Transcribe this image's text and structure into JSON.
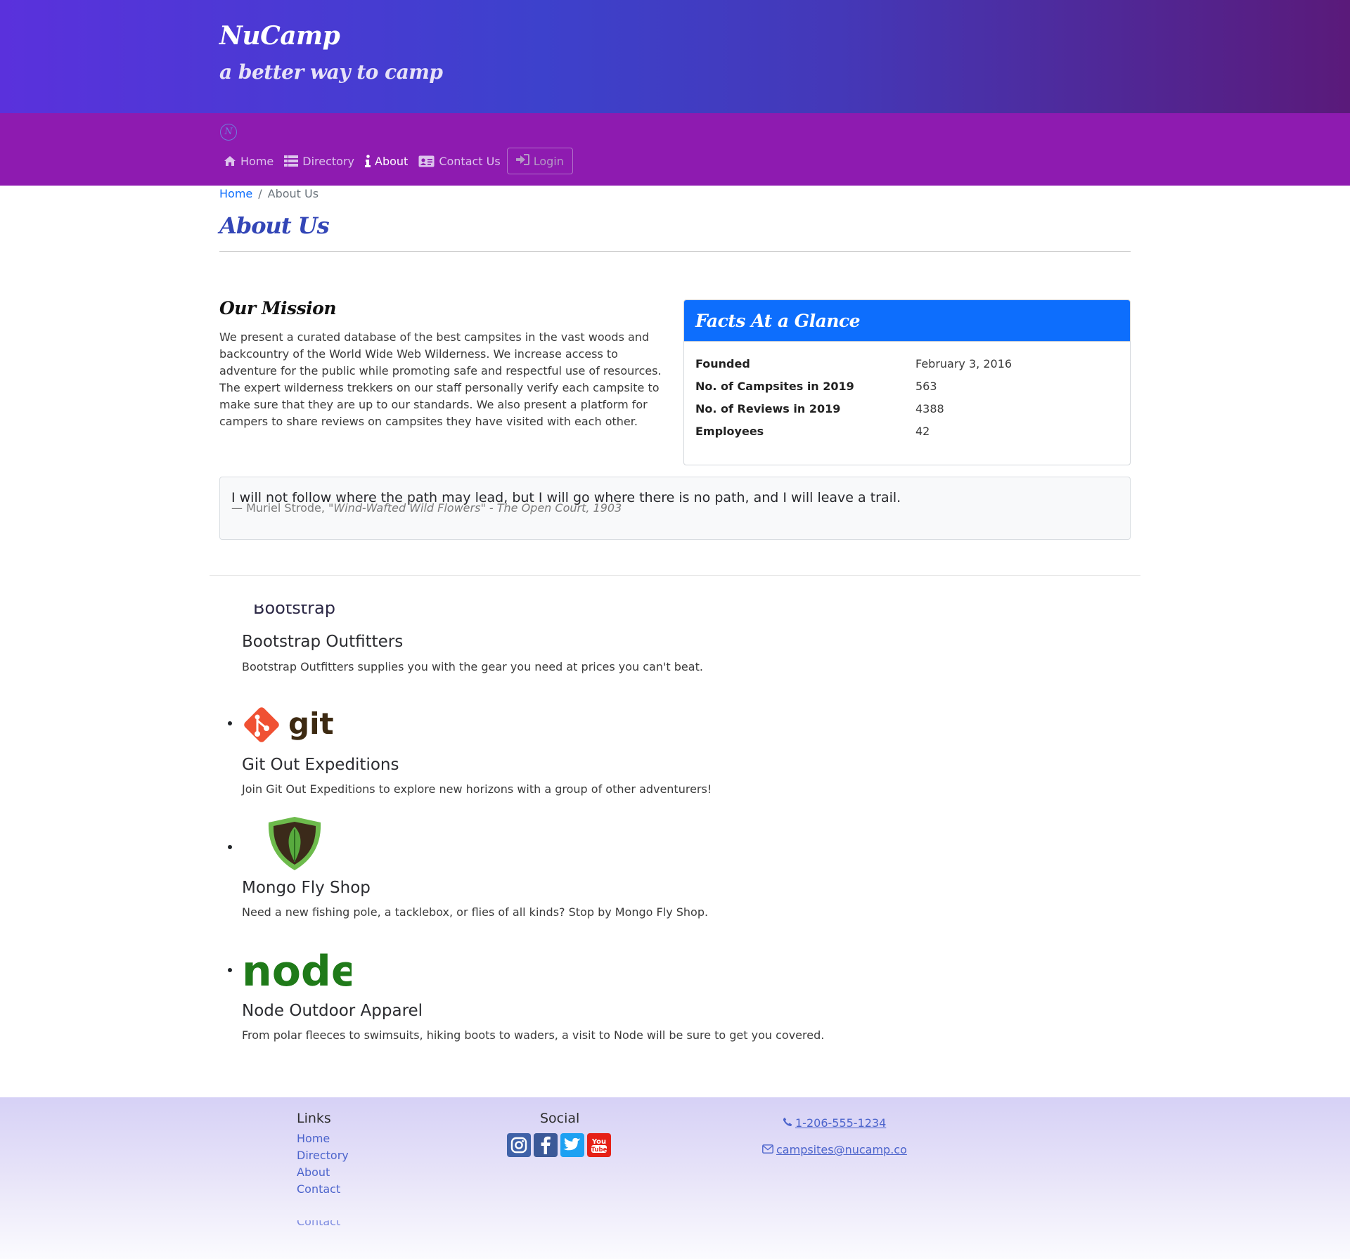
{
  "header": {
    "brand": "NuCamp",
    "tagline": "a better way to camp"
  },
  "nav": {
    "logo_glyph": "N",
    "items": [
      {
        "label": "Home",
        "icon": "home-icon"
      },
      {
        "label": "Directory",
        "icon": "list-icon"
      },
      {
        "label": "About",
        "icon": "info-icon",
        "active": true
      },
      {
        "label": "Contact Us",
        "icon": "address-card-icon"
      }
    ],
    "login_label": "Login"
  },
  "breadcrumb": {
    "home": "Home",
    "separator": "/",
    "current": "About Us"
  },
  "page": {
    "title": "About Us"
  },
  "mission": {
    "title": "Our Mission",
    "text": "We present a curated database of the best campsites in the vast woods and backcountry of the World Wide Web Wilderness. We increase access to adventure for the public while promoting safe and respectful use of resources. The expert wilderness trekkers on our staff personally verify each campsite to make sure that they are up to our standards. We also present a platform for campers to share reviews on campsites they have visited with each other."
  },
  "facts": {
    "title": "Facts At a Glance",
    "rows": [
      {
        "label": "Founded",
        "value": "February 3, 2016"
      },
      {
        "label": "No. of Campsites in 2019",
        "value": "563"
      },
      {
        "label": "No. of Reviews in 2019",
        "value": "4388"
      },
      {
        "label": "Employees",
        "value": "42"
      }
    ]
  },
  "quote": {
    "text": "I will not follow where the path may lead, but I will go where there is no path, and I will leave a trail.",
    "author": "— Muriel Strode, ",
    "source": "\"Wind-Wafted Wild Flowers\" - The Open Court, 1903"
  },
  "partners": {
    "cut_logo_text": "Bootstrap",
    "git_logo_text": "git",
    "node_logo_text": "node",
    "items": [
      {
        "name": "Bootstrap Outfitters",
        "description": "Bootstrap Outfitters supplies you with the gear you need at prices you can't beat."
      },
      {
        "name": "Git Out Expeditions",
        "description": "Join Git Out Expeditions to explore new horizons with a group of other adventurers!"
      },
      {
        "name": "Mongo Fly Shop",
        "description": "Need a new fishing pole, a tacklebox, or flies of all kinds? Stop by Mongo Fly Shop."
      },
      {
        "name": "Node Outdoor Apparel",
        "description": "From polar fleeces to swimsuits, hiking boots to waders, a visit to Node will be sure to get you covered."
      }
    ]
  },
  "footer": {
    "links_title": "Links",
    "links": [
      "Home",
      "Directory",
      "About",
      "Contact"
    ],
    "ghost_link": "Contact",
    "social_title": "Social",
    "social": [
      "instagram-icon",
      "facebook-icon",
      "twitter-icon",
      "youtube-icon"
    ],
    "phone": "1-206-555-1234",
    "email": "campsites@nucamp.co"
  },
  "colors": {
    "navbar": "#8e1bb0",
    "title": "#3346b7",
    "card_header": "#0d6efd",
    "link": "#0d6efd"
  }
}
